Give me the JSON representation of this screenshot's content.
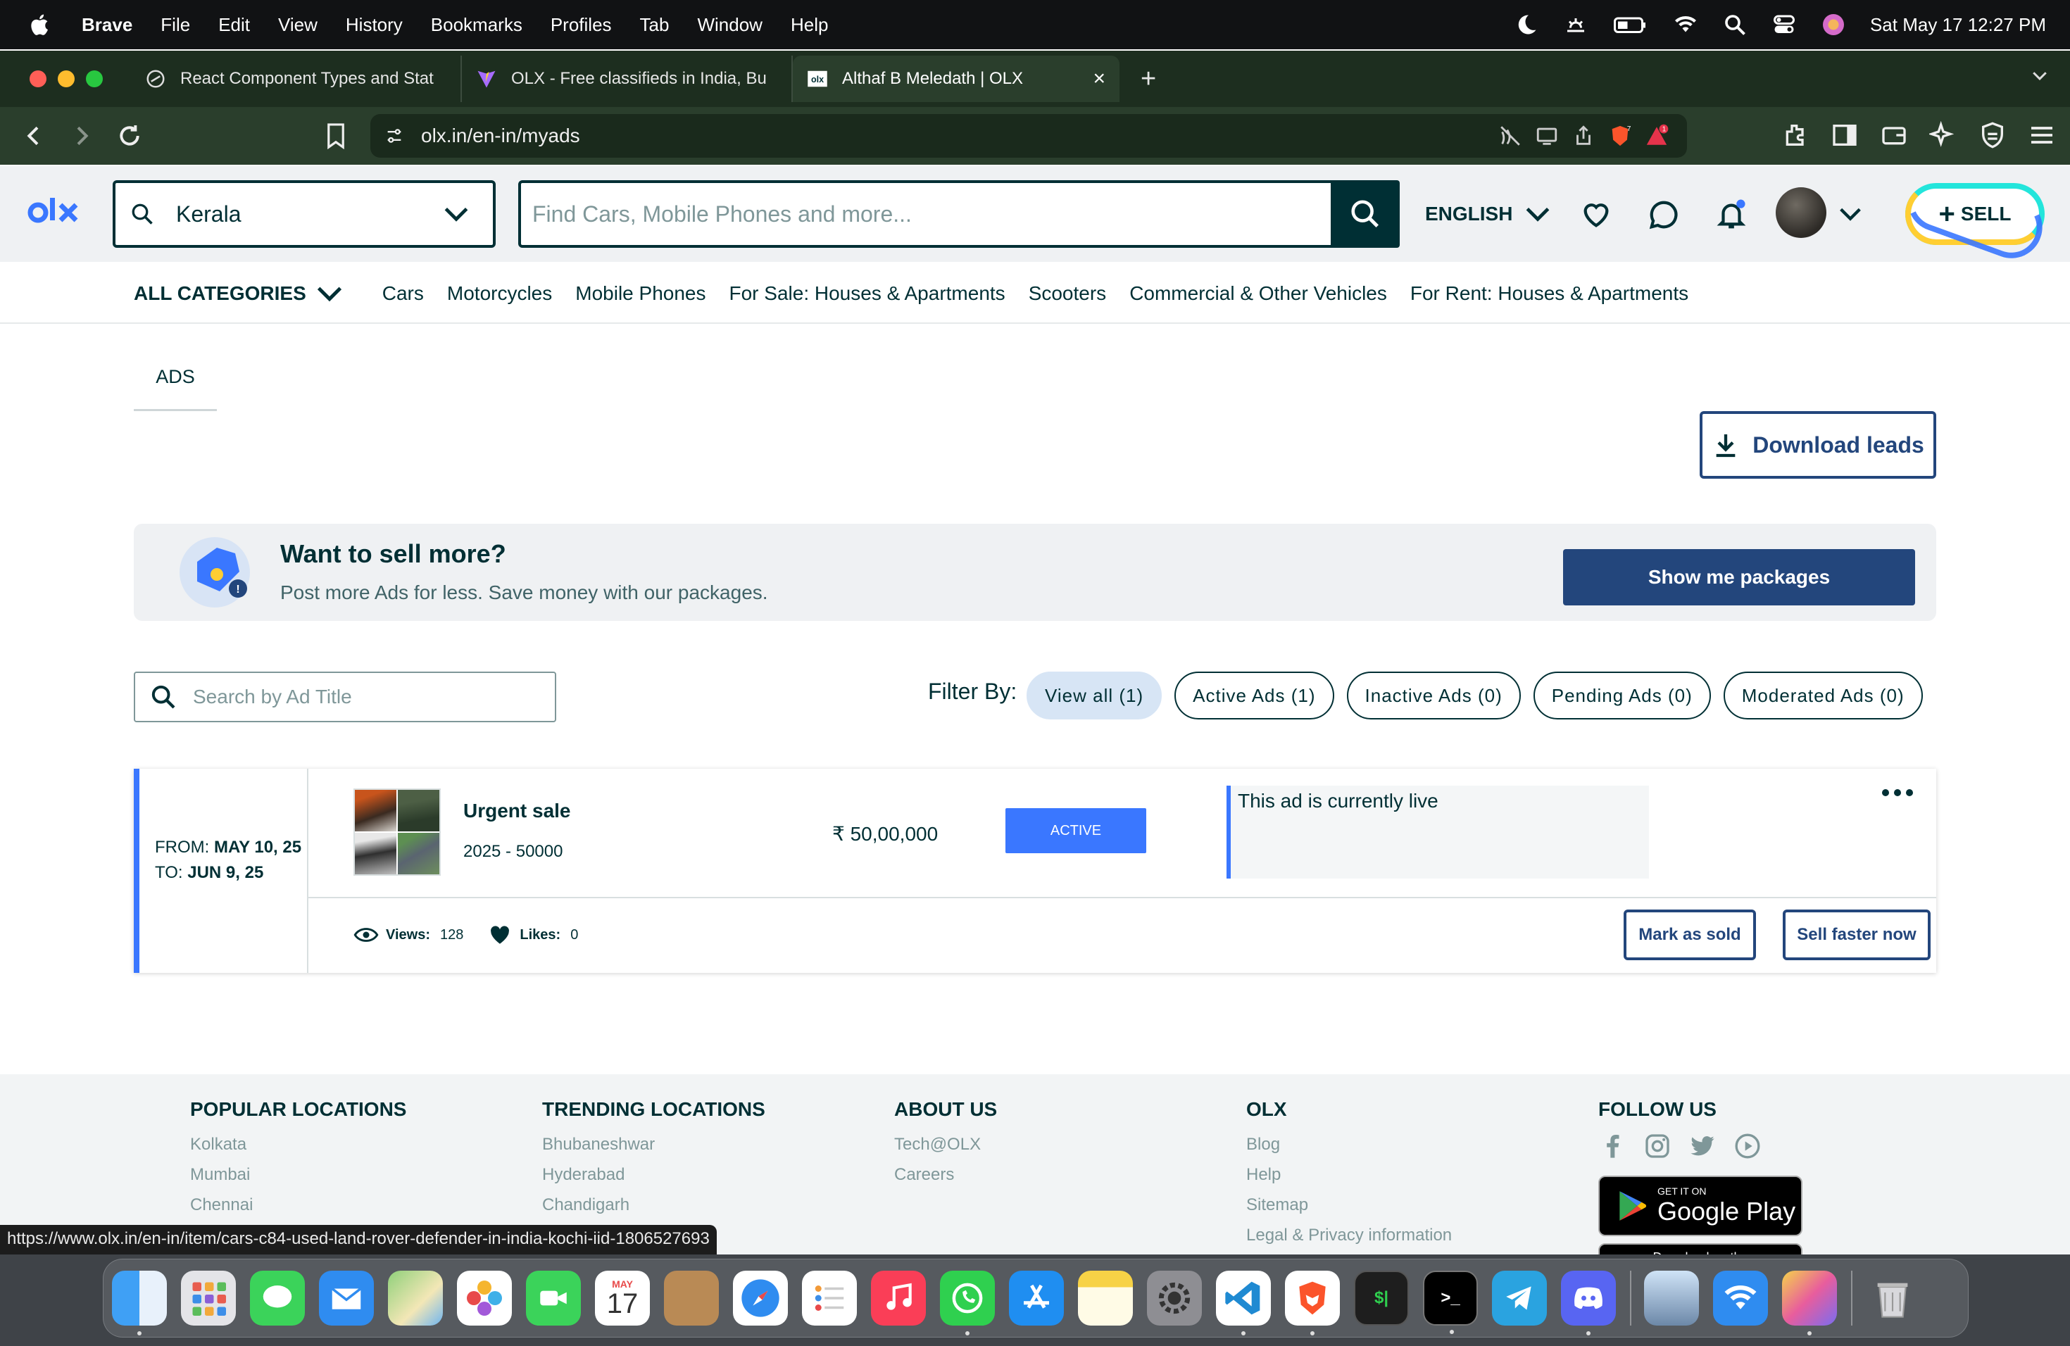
{
  "menubar": {
    "app": "Brave",
    "items": [
      "File",
      "Edit",
      "View",
      "History",
      "Bookmarks",
      "Profiles",
      "Tab",
      "Window",
      "Help"
    ],
    "datetime": "Sat May 17  12:27 PM"
  },
  "tabs": [
    {
      "label": "React Component Types and Stat",
      "icon": "chatgpt-icon"
    },
    {
      "label": "OLX - Free classifieds in India, Bu",
      "icon": "vite-icon"
    },
    {
      "label": "Althaf B Meledath | OLX",
      "icon": "olx-icon",
      "active": true
    }
  ],
  "browser": {
    "url": "olx.in/en-in/myads",
    "shield_count": "7",
    "rewards_count": "1"
  },
  "header": {
    "location": "Kerala",
    "search_placeholder": "Find Cars, Mobile Phones and more...",
    "language": "ENGLISH",
    "sell_label": "SELL"
  },
  "categories": {
    "all_label": "ALL CATEGORIES",
    "items": [
      "Cars",
      "Motorcycles",
      "Mobile Phones",
      "For Sale: Houses & Apartments",
      "Scooters",
      "Commercial & Other Vehicles",
      "For Rent: Houses & Apartments"
    ]
  },
  "page": {
    "ads_tab": "ADS",
    "download_leads": "Download leads"
  },
  "banner": {
    "title": "Want to sell more?",
    "subtitle": "Post more Ads for less. Save money with our packages.",
    "button": "Show me packages"
  },
  "filters": {
    "search_placeholder": "Search by Ad Title",
    "label": "Filter By:",
    "chips": [
      "View all (1)",
      "Active Ads (1)",
      "Inactive Ads (0)",
      "Pending Ads (0)",
      "Moderated Ads (0)"
    ]
  },
  "ad": {
    "from_label": "FROM:",
    "from_date": "MAY 10, 25",
    "to_label": "TO:",
    "to_date": "JUN 9, 25",
    "title": "Urgent sale",
    "subtitle": "2025 - 50000",
    "price": "₹ 50,00,000",
    "status": "ACTIVE",
    "live_text": "This ad is currently live",
    "views_label": "Views:",
    "views": "128",
    "likes_label": "Likes:",
    "likes": "0",
    "mark_sold": "Mark as sold",
    "sell_faster": "Sell faster now"
  },
  "footer": {
    "columns": [
      {
        "title": "POPULAR LOCATIONS",
        "links": [
          "Kolkata",
          "Mumbai",
          "Chennai"
        ]
      },
      {
        "title": "TRENDING LOCATIONS",
        "links": [
          "Bhubaneshwar",
          "Hyderabad",
          "Chandigarh"
        ]
      },
      {
        "title": "ABOUT US",
        "links": [
          "Tech@OLX",
          "Careers"
        ]
      },
      {
        "title": "OLX",
        "links": [
          "Blog",
          "Help",
          "Sitemap",
          "Legal & Privacy information"
        ]
      },
      {
        "title": "FOLLOW US",
        "links": []
      }
    ],
    "gplay_small": "GET IT ON",
    "gplay_big": "Google Play",
    "appstore_text": "Download on the"
  },
  "status_url": "https://www.olx.in/en-in/item/cars-c84-used-land-rover-defender-in-india-kochi-iid-1806527693",
  "dock": {
    "calendar_month": "MAY",
    "calendar_day": "17",
    "apps": [
      "finder",
      "launchpad",
      "messages",
      "mail",
      "maps",
      "photos",
      "facetime",
      "calendar",
      "contacts",
      "safari",
      "reminders",
      "music",
      "whatsapp",
      "app-store",
      "notes",
      "system-settings",
      "vscode",
      "brave",
      "terminal",
      "terminal-2",
      "telegram",
      "discord",
      "preview",
      "wifi-explorer",
      "pages",
      "trash"
    ]
  },
  "colors": {
    "olx_dark": "#002f34",
    "olx_blue": "#23467c",
    "accent_blue": "#3a77ff",
    "teal": "#23e5db",
    "yellow": "#ffce32"
  }
}
